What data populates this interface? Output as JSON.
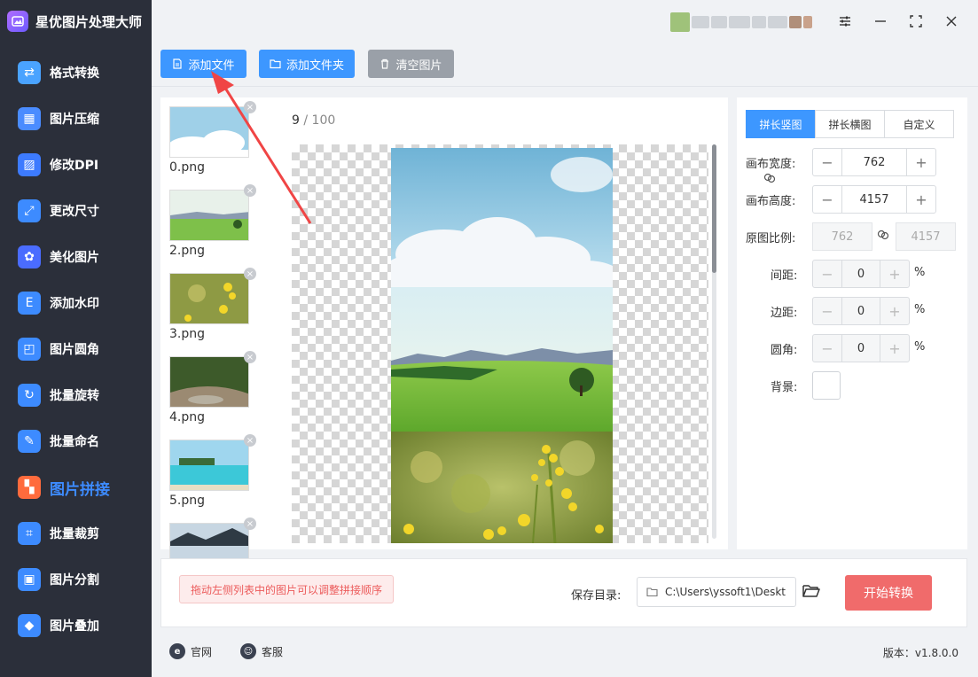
{
  "app": {
    "title": "星优图片处理大师"
  },
  "nav": [
    {
      "label": "格式转换",
      "icon": "image-convert-icon",
      "color": "#4aa3ff"
    },
    {
      "label": "图片压缩",
      "icon": "image-compress-icon",
      "color": "#4a8cff"
    },
    {
      "label": "修改DPI",
      "icon": "dpi-icon",
      "color": "#3d7bff"
    },
    {
      "label": "更改尺寸",
      "icon": "resize-icon",
      "color": "#3d8bff"
    },
    {
      "label": "美化图片",
      "icon": "beautify-icon",
      "color": "#4a6cff"
    },
    {
      "label": "添加水印",
      "icon": "watermark-icon",
      "color": "#3d8bff"
    },
    {
      "label": "图片圆角",
      "icon": "rounded-corner-icon",
      "color": "#3d8bff"
    },
    {
      "label": "批量旋转",
      "icon": "rotate-icon",
      "color": "#3d8bff"
    },
    {
      "label": "批量命名",
      "icon": "rename-icon",
      "color": "#3d8bff"
    },
    {
      "label": "图片拼接",
      "icon": "stitch-icon",
      "color": "#ff6b3d",
      "active": true
    },
    {
      "label": "批量裁剪",
      "icon": "crop-icon",
      "color": "#3d8bff"
    },
    {
      "label": "图片分割",
      "icon": "split-icon",
      "color": "#3d8bff"
    },
    {
      "label": "图片叠加",
      "icon": "overlay-icon",
      "color": "#3d8bff"
    }
  ],
  "toolbar": {
    "add_file": "添加文件",
    "add_folder": "添加文件夹",
    "clear": "清空图片"
  },
  "files": [
    {
      "name": "0.png",
      "thumb": "sky"
    },
    {
      "name": "2.png",
      "thumb": "meadow"
    },
    {
      "name": "3.png",
      "thumb": "flowers"
    },
    {
      "name": "4.png",
      "thumb": "river"
    },
    {
      "name": "5.png",
      "thumb": "beach"
    },
    {
      "name": "",
      "thumb": "mountain"
    }
  ],
  "preview": {
    "current": "9",
    "separator": " / ",
    "total": "100"
  },
  "settings": {
    "tabs": [
      "拼长竖图",
      "拼长横图",
      "自定义"
    ],
    "active_tab": 0,
    "canvas_width_label": "画布宽度:",
    "canvas_width": "762",
    "canvas_height_label": "画布高度:",
    "canvas_height": "4157",
    "ratio_label": "原图比例:",
    "ratio_w": "762",
    "ratio_h": "4157",
    "spacing_label": "间距:",
    "spacing": "0",
    "margin_label": "边距:",
    "margin": "0",
    "radius_label": "圆角:",
    "radius": "0",
    "percent": "%",
    "bg_label": "背景:"
  },
  "bottom": {
    "hint": "拖动左侧列表中的图片可以调整拼接顺序",
    "save_label": "保存目录:",
    "save_path": "C:\\Users\\yssoft1\\Deskt",
    "start": "开始转换"
  },
  "footer": {
    "website": "官网",
    "support": "客服",
    "version": "版本：v1.8.0.0"
  },
  "colors": {
    "accent": "#3d97ff",
    "danger": "#f06b6b",
    "sidebar": "#2b2f3a"
  }
}
